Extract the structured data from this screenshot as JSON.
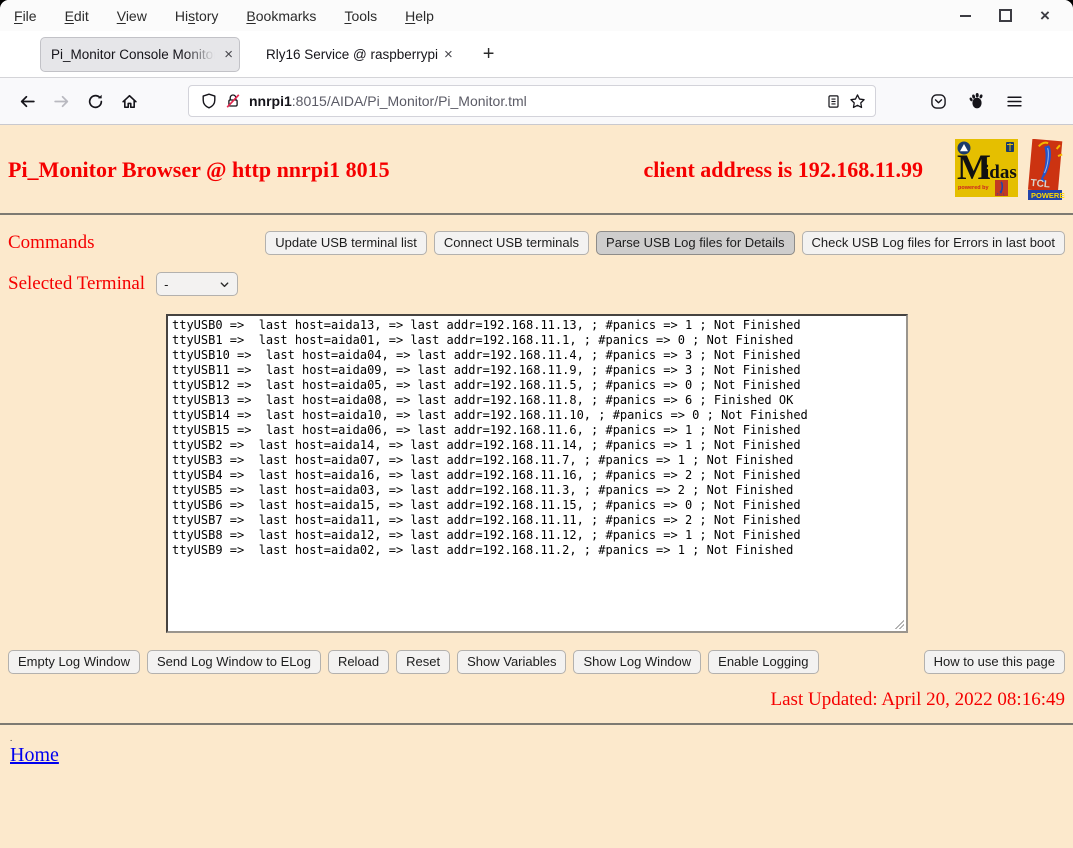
{
  "window": {
    "menubar": [
      {
        "label": "File",
        "underline": 0
      },
      {
        "label": "Edit",
        "underline": 0
      },
      {
        "label": "View",
        "underline": 0
      },
      {
        "label": "History",
        "underline": 2
      },
      {
        "label": "Bookmarks",
        "underline": 0
      },
      {
        "label": "Tools",
        "underline": 0
      },
      {
        "label": "Help",
        "underline": 0
      }
    ]
  },
  "tabs": {
    "tab1": "Pi_Monitor Console Monitorin",
    "tab2": "Rly16 Service @ raspberrypi",
    "close_glyph": "×",
    "new_tab_glyph": "+"
  },
  "navbar": {
    "url_host": "nnrpi1",
    "url_path": ":8015/AIDA/Pi_Monitor/Pi_Monitor.tml"
  },
  "page": {
    "title": "Pi_Monitor Browser @ http nnrpi1 8015",
    "client_address": "client address is 192.168.11.99",
    "commands_label": "Commands",
    "buttons": {
      "update": "Update USB terminal list",
      "connect": "Connect USB terminals",
      "parse": "Parse USB Log files for Details",
      "check": "Check USB Log files for Errors in last boot",
      "empty": "Empty Log Window",
      "send": "Send Log Window to ELog",
      "reload": "Reload",
      "reset": "Reset",
      "show_vars": "Show Variables",
      "show_log": "Show Log Window",
      "enable_log": "Enable Logging",
      "help": "How to use this page"
    },
    "selected_terminal_label": "Selected Terminal",
    "terminal_value": "-",
    "log_lines": [
      "ttyUSB0 =>  last host=aida13, => last addr=192.168.11.13, ; #panics => 1 ; Not Finished",
      "ttyUSB1 =>  last host=aida01, => last addr=192.168.11.1, ; #panics => 0 ; Not Finished",
      "ttyUSB10 =>  last host=aida04, => last addr=192.168.11.4, ; #panics => 3 ; Not Finished",
      "ttyUSB11 =>  last host=aida09, => last addr=192.168.11.9, ; #panics => 3 ; Not Finished",
      "ttyUSB12 =>  last host=aida05, => last addr=192.168.11.5, ; #panics => 0 ; Not Finished",
      "ttyUSB13 =>  last host=aida08, => last addr=192.168.11.8, ; #panics => 6 ; Finished OK",
      "ttyUSB14 =>  last host=aida10, => last addr=192.168.11.10, ; #panics => 0 ; Not Finished",
      "ttyUSB15 =>  last host=aida06, => last addr=192.168.11.6, ; #panics => 1 ; Not Finished",
      "ttyUSB2 =>  last host=aida14, => last addr=192.168.11.14, ; #panics => 1 ; Not Finished",
      "ttyUSB3 =>  last host=aida07, => last addr=192.168.11.7, ; #panics => 1 ; Not Finished",
      "ttyUSB4 =>  last host=aida16, => last addr=192.168.11.16, ; #panics => 2 ; Not Finished",
      "ttyUSB5 =>  last host=aida03, => last addr=192.168.11.3, ; #panics => 2 ; Not Finished",
      "ttyUSB6 =>  last host=aida15, => last addr=192.168.11.15, ; #panics => 0 ; Not Finished",
      "ttyUSB7 =>  last host=aida11, => last addr=192.168.11.11, ; #panics => 2 ; Not Finished",
      "ttyUSB8 =>  last host=aida12, => last addr=192.168.11.12, ; #panics => 1 ; Not Finished",
      "ttyUSB9 =>  last host=aida02, => last addr=192.168.11.2, ; #panics => 1 ; Not Finished"
    ],
    "last_updated": "Last Updated: April 20, 2022 08:16:49",
    "dot": ".",
    "home": "Home"
  },
  "logos": {
    "midas_m": "M",
    "midas_rest": "idas",
    "midas_powered": "powered by",
    "tcl_name": "TCL",
    "tcl_powered": "POWERED"
  },
  "colors": {
    "page_bg": "#fce9cc",
    "accent_red": "#f50000",
    "link_blue": "#0000ee",
    "midas_yellow": "#e5bf00",
    "tcl_red": "#cc3311",
    "tcl_blue": "#2244aa"
  }
}
